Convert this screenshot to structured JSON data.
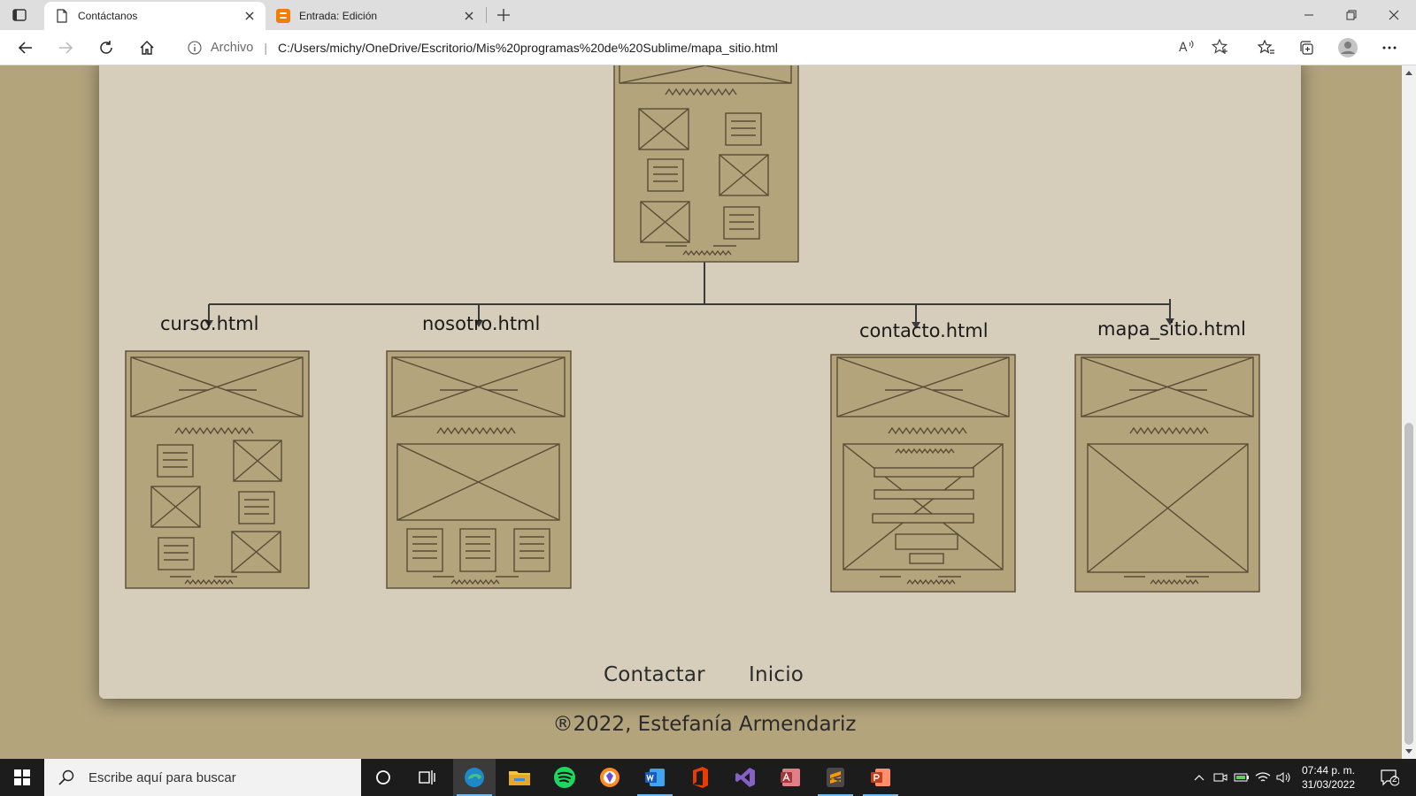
{
  "browser": {
    "tabs": [
      {
        "title": "Contáctanos",
        "active": true
      },
      {
        "title": "Entrada: Edición",
        "active": false
      }
    ],
    "address": {
      "scheme_label": "Archivo",
      "url": "C:/Users/michy/OneDrive/Escritorio/Mis%20programas%20de%20Sublime/mapa_sitio.html"
    }
  },
  "sitemap": {
    "nodes": [
      {
        "label": "curso.html"
      },
      {
        "label": "nosotro.html"
      },
      {
        "label": "contacto.html"
      },
      {
        "label": "mapa_sitio.html"
      }
    ]
  },
  "footer": {
    "links": [
      "Contactar",
      "Inicio"
    ],
    "copyright": "®2022, Estefanía Armendariz"
  },
  "taskbar": {
    "search_placeholder": "Escribe aquí para buscar",
    "time": "07:44 p. m.",
    "date": "31/03/2022",
    "notification_count": "2"
  },
  "colors": {
    "page_bg": "#b3a47c",
    "panel_bg": "#d6cebb",
    "wireframe_fill": "#b3a47c",
    "wireframe_stroke": "#5a4c36",
    "taskbar_bg": "#1c1c1c"
  }
}
